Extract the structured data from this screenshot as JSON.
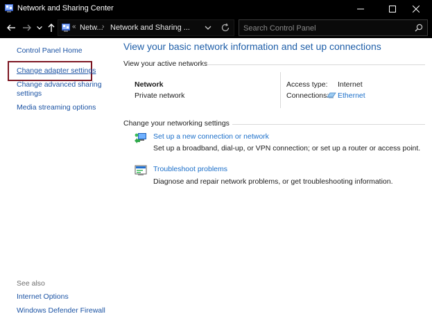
{
  "window": {
    "title": "Network and Sharing Center",
    "icon": "network-center-icon",
    "controls": [
      "minimize-icon",
      "maximize-icon",
      "close-icon"
    ]
  },
  "navigation": {
    "back_icon": "arrow-left-icon",
    "forward_icon": "arrow-right-icon",
    "recent_icon": "chevron-down-icon",
    "up_icon": "arrow-up-icon",
    "address": {
      "separator": "«",
      "crumbs": [
        "Netw...",
        "Network and Sharing ..."
      ]
    },
    "refresh_icon": "refresh-icon"
  },
  "search": {
    "placeholder": "Search Control Panel",
    "value": ""
  },
  "sidebar": {
    "home": "Control Panel Home",
    "links": [
      "Change adapter settings",
      "Change advanced sharing settings",
      "Media streaming options"
    ],
    "adv_line1": "Change advanced sharing",
    "adv_line2": "settings",
    "see_also_title": "See also",
    "see_also": [
      "Internet Options",
      "Windows Defender Firewall"
    ]
  },
  "main": {
    "heading": "View your basic network information and set up connections",
    "active_networks": {
      "title": "View your active networks",
      "network_name": "Network",
      "network_category": "Private network",
      "access_type_label": "Access type:",
      "access_type_value": "Internet",
      "connections_label": "Connections:",
      "connection_name": "Ethernet"
    },
    "networking_settings": {
      "title": "Change your networking settings",
      "tasks": [
        {
          "title": "Set up a new connection or network",
          "description": "Set up a broadband, dial-up, or VPN connection; or set up a router or access point.",
          "icon": "new-connection-icon"
        },
        {
          "title": "Troubleshoot problems",
          "description": "Diagnose and repair network problems, or get troubleshooting information.",
          "icon": "troubleshoot-icon"
        }
      ]
    }
  },
  "colors": {
    "titlebar": "#000000",
    "link": "#1a6ec9",
    "heading": "#1e5ea8",
    "highlight_box": "#7b1420"
  }
}
